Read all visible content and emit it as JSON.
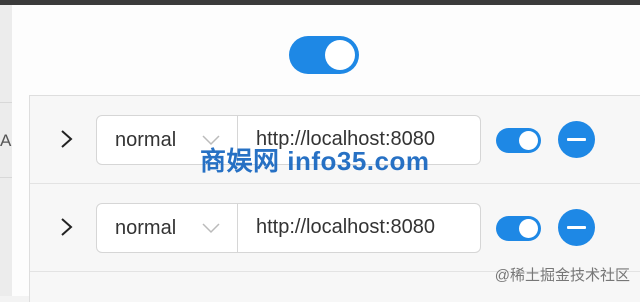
{
  "sidebar": {
    "partial_label": "A"
  },
  "main_toggle": {
    "enabled": true
  },
  "rows": [
    {
      "mode": "normal",
      "url": "http://localhost:8080",
      "enabled": true
    },
    {
      "mode": "normal",
      "url": "http://localhost:8080",
      "enabled": true
    }
  ],
  "watermark": "商娱网 info35.com",
  "credit": "@稀土掘金技术社区",
  "colors": {
    "accent": "#1e88e5",
    "watermark": "#1565c0"
  },
  "icons": {
    "expand": "chevron-right-icon",
    "select_caret": "chevron-down-icon",
    "remove": "minus-circle-icon"
  }
}
